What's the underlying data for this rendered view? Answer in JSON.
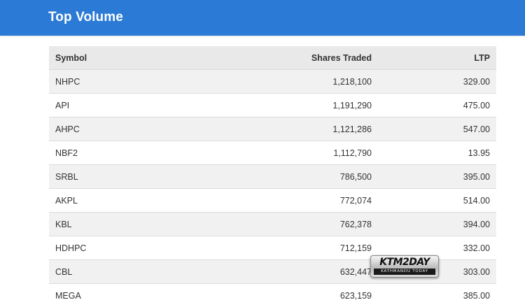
{
  "header": {
    "title": "Top Volume"
  },
  "table": {
    "columns": {
      "symbol": "Symbol",
      "shares": "Shares Traded",
      "ltp": "LTP"
    },
    "rows": [
      {
        "symbol": "NHPC",
        "shares": "1,218,100",
        "ltp": "329.00"
      },
      {
        "symbol": "API",
        "shares": "1,191,290",
        "ltp": "475.00"
      },
      {
        "symbol": "AHPC",
        "shares": "1,121,286",
        "ltp": "547.00"
      },
      {
        "symbol": "NBF2",
        "shares": "1,112,790",
        "ltp": "13.95"
      },
      {
        "symbol": "SRBL",
        "shares": "786,500",
        "ltp": "395.00"
      },
      {
        "symbol": "AKPL",
        "shares": "772,074",
        "ltp": "514.00"
      },
      {
        "symbol": "KBL",
        "shares": "762,378",
        "ltp": "394.00"
      },
      {
        "symbol": "HDHPC",
        "shares": "712,159",
        "ltp": "332.00"
      },
      {
        "symbol": "CBL",
        "shares": "632,447",
        "ltp": "303.00"
      },
      {
        "symbol": "MEGA",
        "shares": "623,159",
        "ltp": "385.00"
      }
    ]
  },
  "watermark": {
    "main": "KTM2DAY",
    "sub": "KATHMANDU TODAY"
  }
}
